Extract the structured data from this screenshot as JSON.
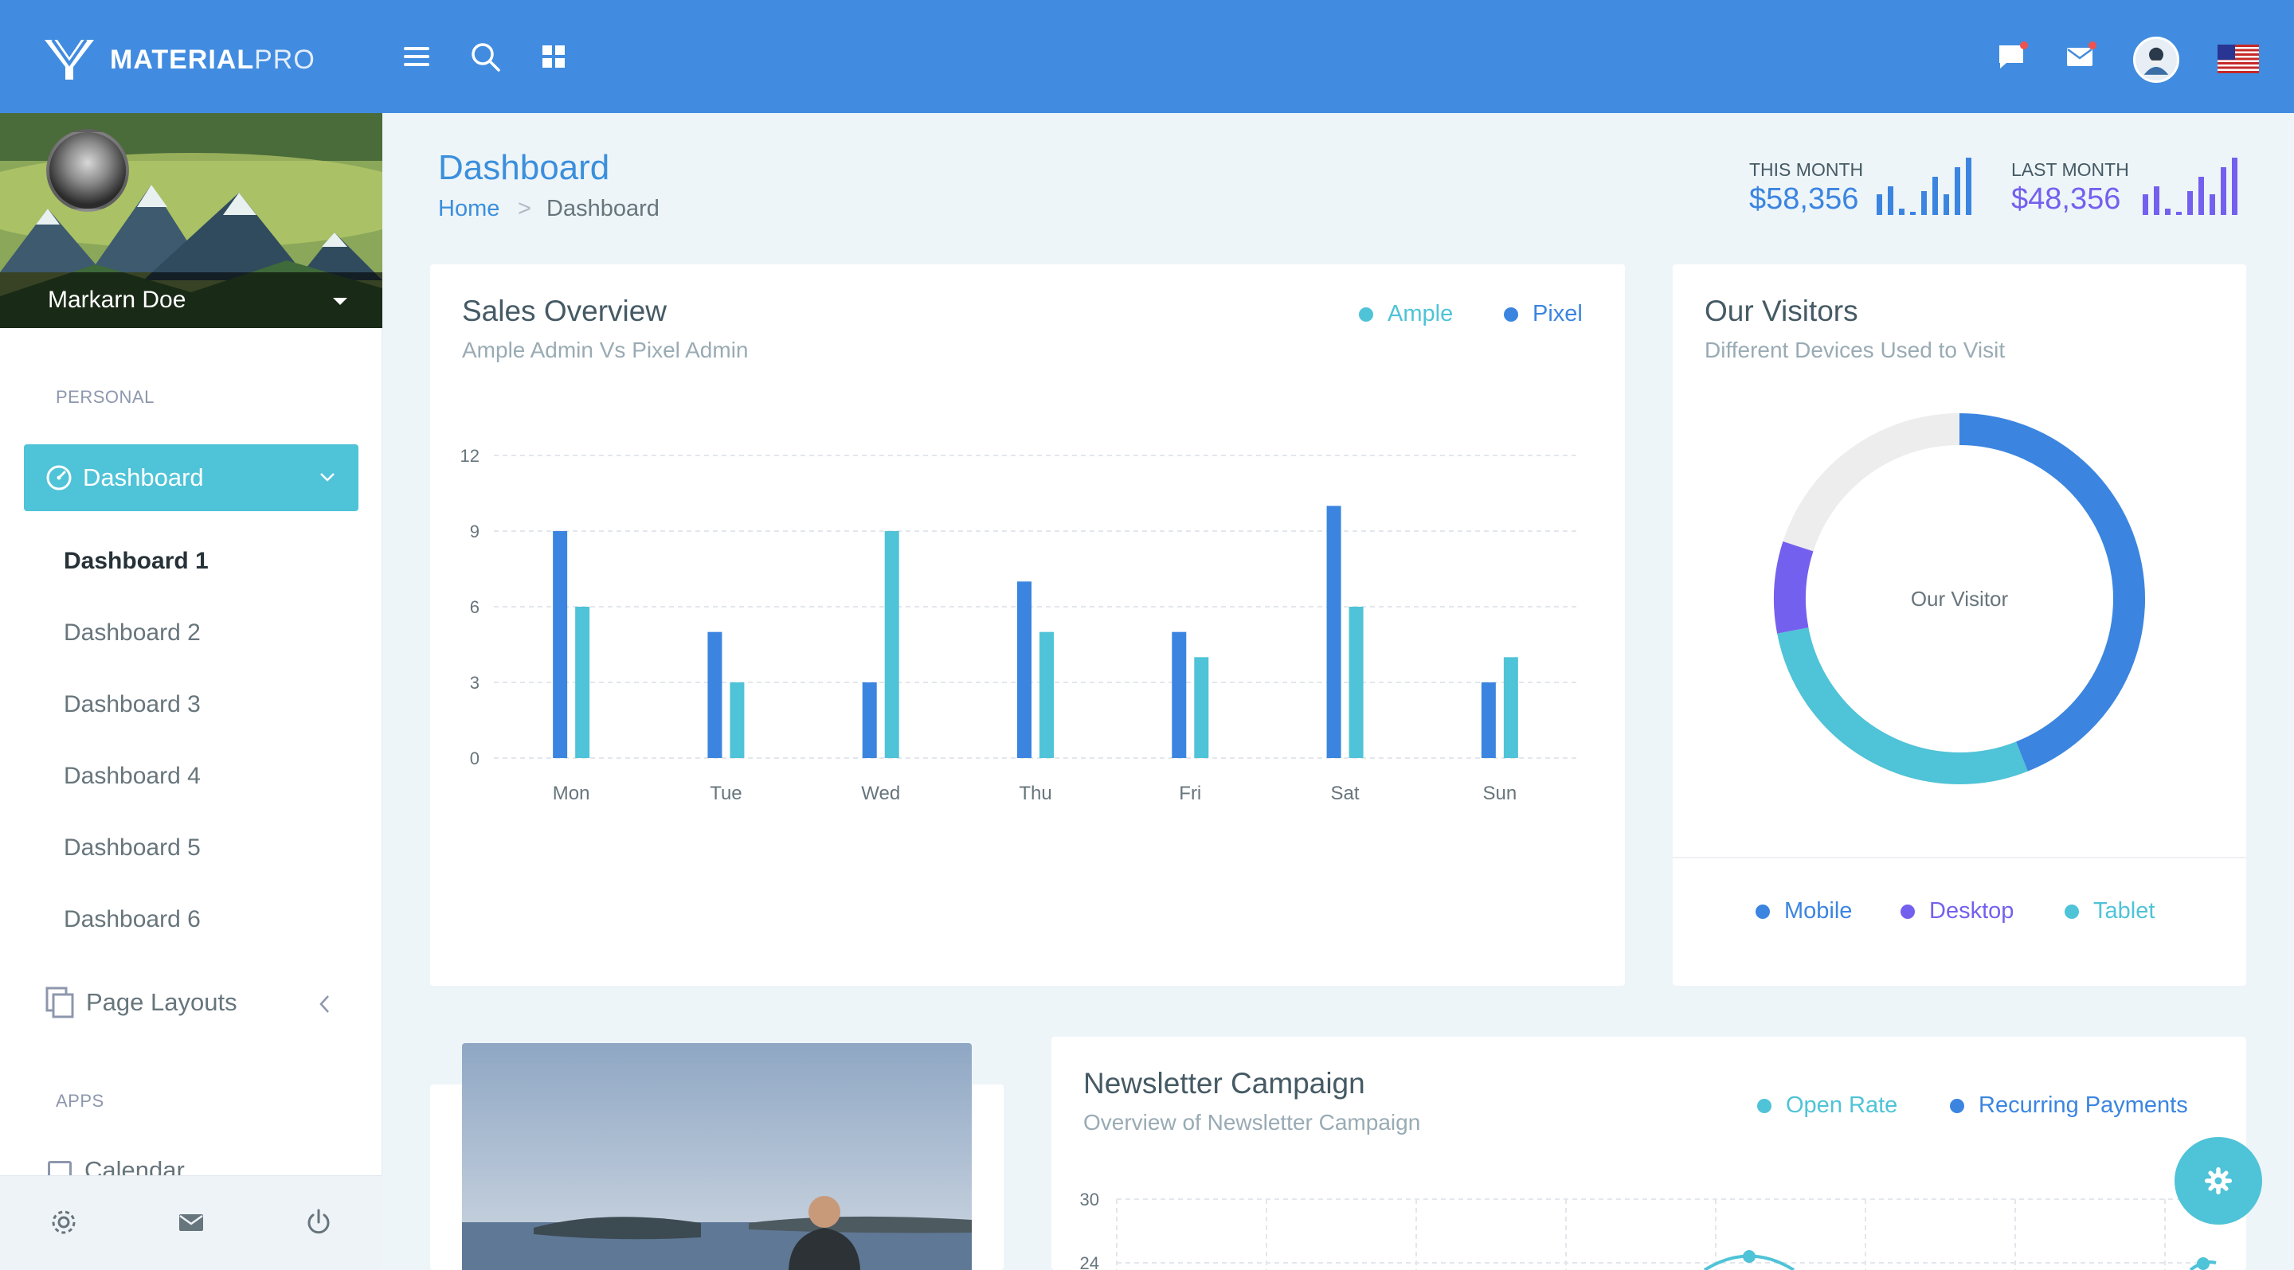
{
  "brand": {
    "bold": "MATERIAL",
    "light": "PRO"
  },
  "colors": {
    "primary": "#418ce0",
    "info": "#4fc3d7",
    "purple": "#7460ee",
    "blue": "#3b85e0"
  },
  "topbar_icons": [
    "menu-icon",
    "search-icon",
    "grid-icon",
    "chat-icon",
    "mail-icon",
    "avatar",
    "us-flag-icon"
  ],
  "sidebar": {
    "user_name": "Markarn Doe",
    "personal_caption": "PERSONAL",
    "active_item": "Dashboard",
    "sub_items": [
      "Dashboard 1",
      "Dashboard 2",
      "Dashboard 3",
      "Dashboard 4",
      "Dashboard 5",
      "Dashboard 6"
    ],
    "page_layouts": "Page Layouts",
    "apps_caption": "APPS",
    "partial_item": "Calendar",
    "footer_icons": [
      "settings-icon",
      "mail-icon",
      "power-icon"
    ]
  },
  "page": {
    "title": "Dashboard",
    "breadcrumb": {
      "home": "Home",
      "separator": ">",
      "current": "Dashboard"
    }
  },
  "stats": {
    "this_month": {
      "label": "THIS MONTH",
      "value": "$58,356",
      "color": "#3b85e0"
    },
    "last_month": {
      "label": "LAST MONTH",
      "value": "$48,356",
      "color": "#7460ee"
    }
  },
  "sales_overview": {
    "title": "Sales Overview",
    "subtitle": "Ample Admin Vs Pixel Admin",
    "legend": [
      {
        "name": "Ample",
        "color": "#4fc3d7"
      },
      {
        "name": "Pixel",
        "color": "#3b85e0"
      }
    ]
  },
  "visitors": {
    "title": "Our Visitors",
    "subtitle": "Different Devices Used to Visit",
    "center_label": "Our Visitor",
    "legend": [
      {
        "name": "Mobile",
        "color": "#3b85e0"
      },
      {
        "name": "Desktop",
        "color": "#7460ee"
      },
      {
        "name": "Tablet",
        "color": "#4fc3d7"
      }
    ]
  },
  "newsletter": {
    "title": "Newsletter Campaign",
    "subtitle": "Overview of Newsletter Campaign",
    "legend": [
      {
        "name": "Open Rate",
        "color": "#4fc3d7"
      },
      {
        "name": "Recurring Payments",
        "color": "#3b85e0"
      }
    ],
    "visible_ticks": [
      "30",
      "24"
    ]
  },
  "chart_data": [
    {
      "type": "bar",
      "categories": [
        "Mon",
        "Tue",
        "Wed",
        "Thu",
        "Fri",
        "Sat",
        "Sun"
      ],
      "series": [
        {
          "name": "Pixel",
          "color": "#3b85e0",
          "values": [
            9,
            5,
            3,
            7,
            5,
            10,
            3
          ]
        },
        {
          "name": "Ample",
          "color": "#4fc3d7",
          "values": [
            6,
            3,
            9,
            5,
            4,
            6,
            4
          ]
        }
      ],
      "yticks": [
        "0",
        "3",
        "6",
        "9",
        "12"
      ],
      "ylim": [
        0,
        12
      ],
      "grid": true,
      "title": "Sales Overview"
    },
    {
      "type": "pie",
      "categories": [
        "Mobile",
        "Tablet",
        "Desktop"
      ],
      "values": [
        44,
        28,
        8
      ],
      "unfilled": 20,
      "colors": [
        "#3b85e0",
        "#4fc3d7",
        "#7460ee"
      ],
      "title": "Our Visitors"
    }
  ]
}
